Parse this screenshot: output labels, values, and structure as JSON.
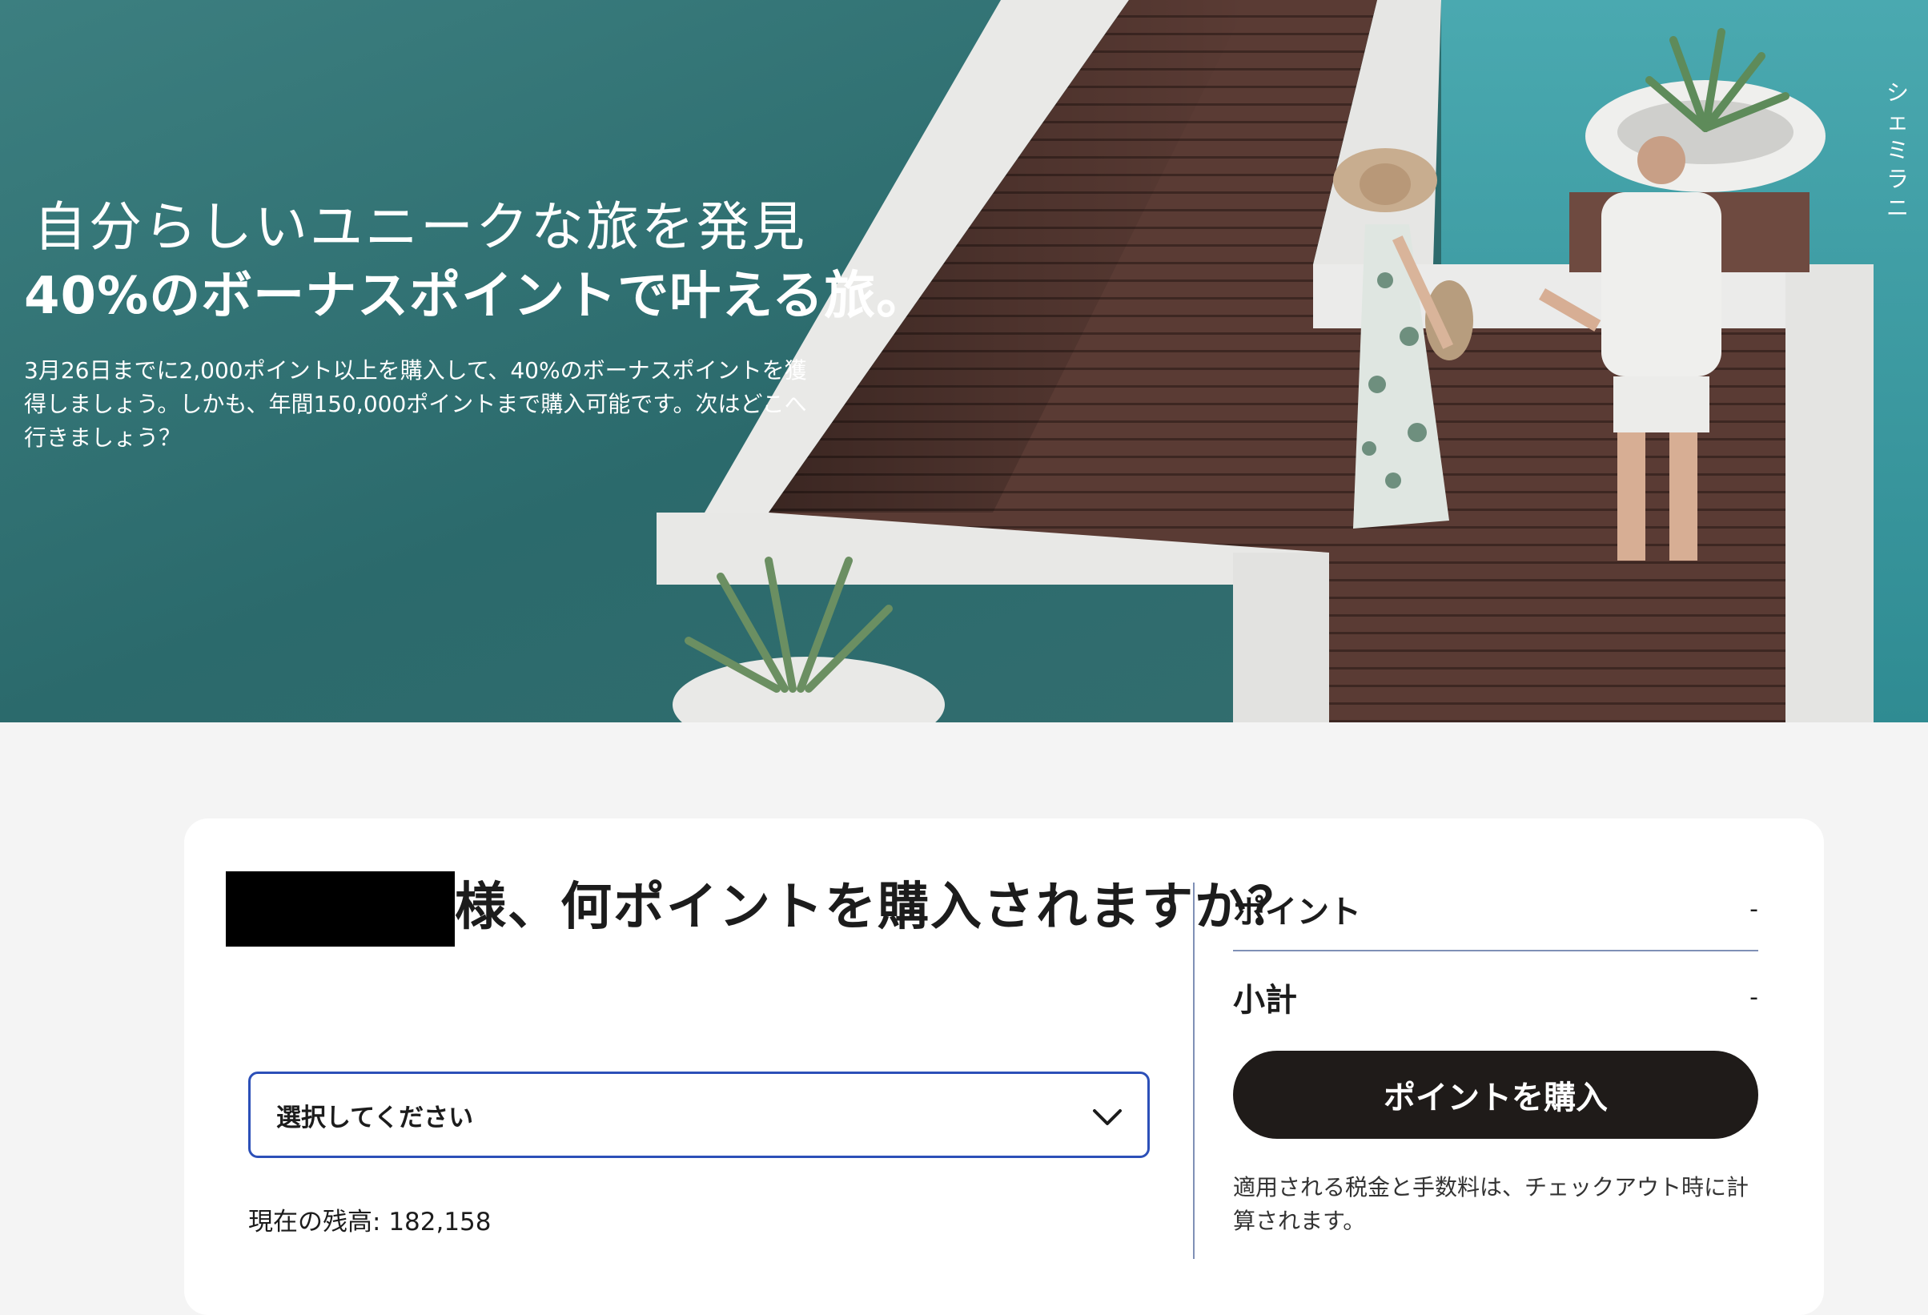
{
  "hero": {
    "title": "自分らしいユニークな旅を発見",
    "subtitle": "40%のボーナスポイントで叶える旅。",
    "body": "3月26日までに2,000ポイント以上を購入して、40%のボーナスポイントを獲得しましょう。しかも、年間150,000ポイントまで購入可能です。次はどこへ行きましょう？",
    "side_text": "シェミラニ"
  },
  "purchase": {
    "question": "様、何ポイントを購入されますか？",
    "select_placeholder": "選択してください",
    "balance_label": "現在の残高: ",
    "balance_value": "182,158"
  },
  "summary": {
    "points_label": "ポイント",
    "points_value": "-",
    "subtotal_label": "小計",
    "subtotal_value": "-",
    "buy_button": "ポイントを購入",
    "tax_note": "適用される税金と手数料は、チェックアウト時に計算されます。"
  },
  "colors": {
    "button_bg": "#1f1b19",
    "select_border": "#2c50b8",
    "divider": "#7f90b6",
    "page_bg": "#f4f4f4"
  },
  "icons": {
    "select_chevron": "chevron-down-icon"
  }
}
